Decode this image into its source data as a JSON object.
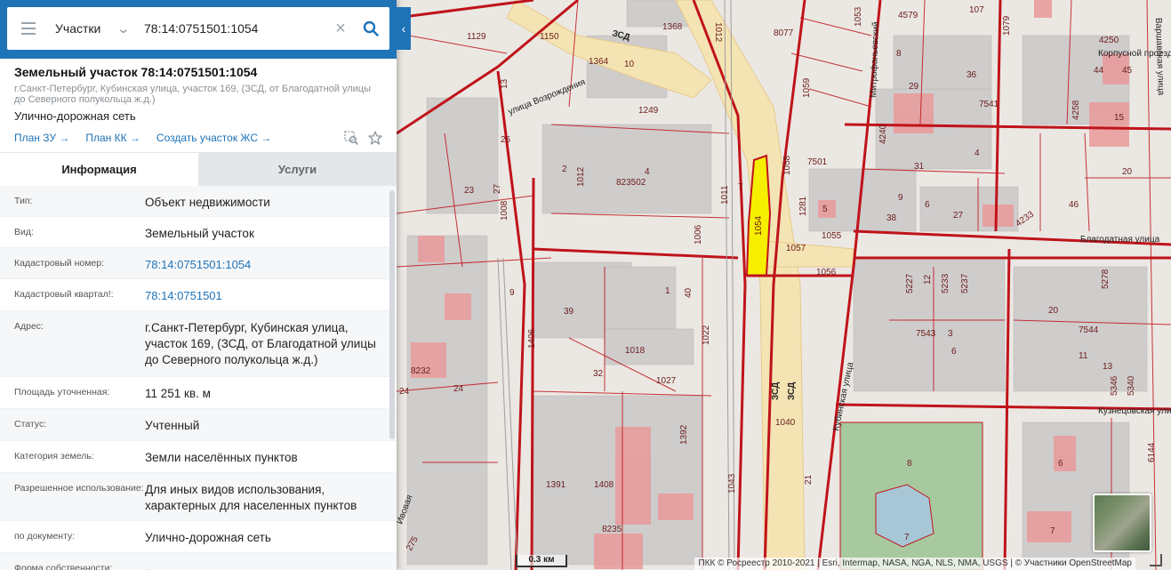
{
  "search": {
    "type_label": "Участки",
    "query": "78:14:0751501:1054"
  },
  "object": {
    "title": "Земельный участок 78:14:0751501:1054",
    "address_short": "г.Санкт-Петербург, Кубинская улица, участок 169, (ЗСД, от Благодатной улицы до Северного полукольца ж.д.)",
    "use": "Улично-дорожная сеть",
    "links": [
      "План ЗУ →",
      "План КК →",
      "Создать участок ЖС →"
    ]
  },
  "tabs": [
    "Информация",
    "Услуги"
  ],
  "info": [
    {
      "label": "Тип:",
      "value": "Объект недвижимости"
    },
    {
      "label": "Вид:",
      "value": "Земельный участок"
    },
    {
      "label": "Кадастровый номер:",
      "value": "78:14:0751501:1054"
    },
    {
      "label": "Кадастровый квартал!:",
      "value": "78:14:0751501"
    },
    {
      "label": "Адрес:",
      "value": "г.Санкт-Петербург, Кубинская улица, участок 169, (ЗСД, от Благодатной улицы до Северного полукольца ж.д.)"
    },
    {
      "label": "Площадь уточненная:",
      "value": "11 251 кв. м"
    },
    {
      "label": "Статус:",
      "value": "Учтенный"
    },
    {
      "label": "Категория земель:",
      "value": "Земли населённых пунктов"
    },
    {
      "label": "Разрешенное использование:",
      "value": "Для иных видов использования, характерных для населенных пунктов"
    },
    {
      "label": "по документу:",
      "value": "Улично-дорожная сеть"
    },
    {
      "label": "Форма собственности:",
      "value": "-"
    }
  ],
  "map": {
    "scale_label": "0.3 км",
    "attribution": "ПКК © Росреестр 2010-2021 | Esri, Intermap, NASA, NGA, NLS, NMA, USGS | © Участники OpenStreetMap",
    "streets": [
      "улица Возрождения",
      "Митрофаньевский",
      "Корпусной проезд",
      "Варшавская улица",
      "Благодатная улица",
      "Кубинская улица",
      "Кузнецовская улица",
      "ЗСД",
      "ЗСД",
      "Ивовая"
    ],
    "parcel_numbers": [
      "1129",
      "1150",
      "1368",
      "8077",
      "1012",
      "1053",
      "4579",
      "107",
      "1079",
      "4250",
      "8",
      "1364",
      "10",
      "13",
      "1249",
      "1059",
      "29",
      "36",
      "7541",
      "4258",
      "45",
      "44",
      "15",
      "26",
      "2",
      "1012",
      "4",
      "823502",
      "1011",
      "7",
      "1058",
      "1281",
      "7501",
      "4240",
      "31",
      "20",
      "5",
      "1008",
      "1006",
      "1054",
      "1057",
      "1055",
      "38",
      "27",
      "4233",
      "46",
      "48",
      "40",
      "39",
      "1056",
      "5227",
      "12",
      "5233",
      "5237",
      "5278",
      "8232",
      "1406",
      "1022",
      "1018",
      "1027",
      "32",
      "7543",
      "3",
      "20",
      "7544",
      "11",
      "13",
      "5346",
      "5340",
      "24",
      "9",
      "1392",
      "1043",
      "1040",
      "21",
      "8",
      "7",
      "1391",
      "1408",
      "8235",
      "275",
      "6144",
      "1054",
      "23",
      "27",
      "6",
      "7",
      "9",
      "1",
      "6",
      "7",
      "4",
      "9"
    ],
    "highlight_color": "#f6f000",
    "boundary_color": "#c0131b"
  },
  "colors": {
    "accent": "#1f73b7",
    "link": "#1f73b7",
    "tab_inactive": "#e4e7ea"
  },
  "icons": [
    "menu-icon",
    "chevron-down-icon",
    "close-icon",
    "search-icon",
    "chevron-left-icon",
    "zoom-selection-icon",
    "star-icon"
  ]
}
